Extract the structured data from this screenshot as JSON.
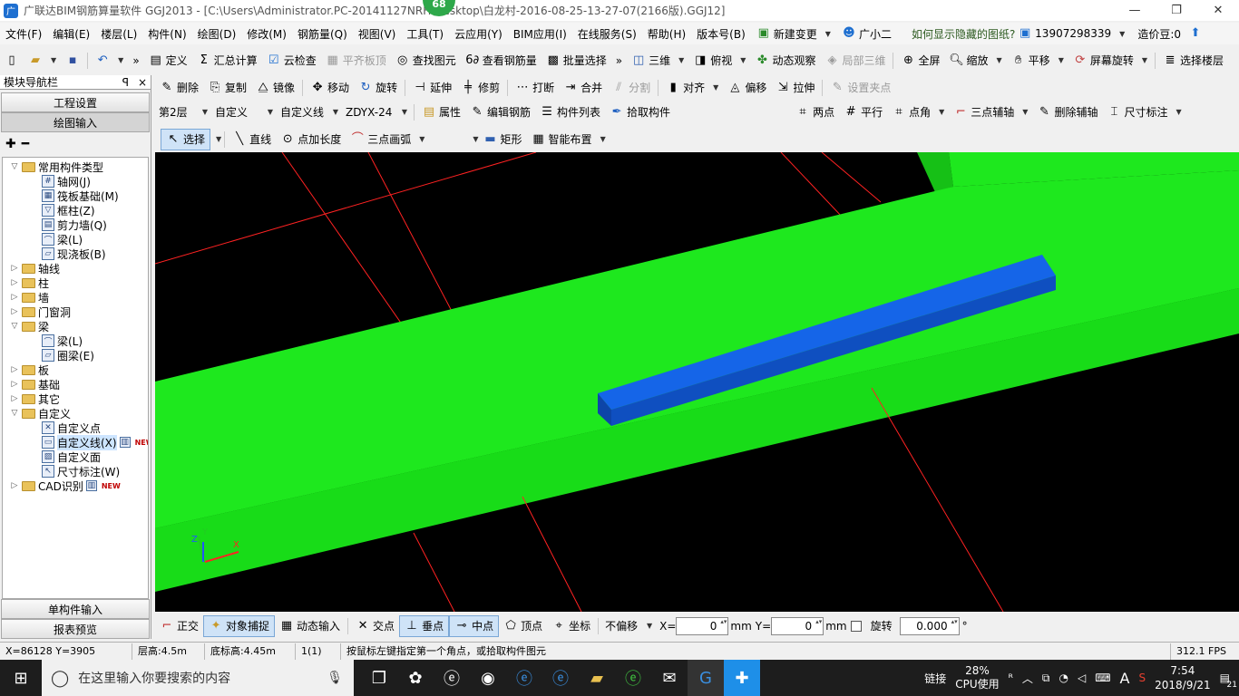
{
  "window": {
    "title": "广联达BIM钢筋算量软件 GGJ2013 - [C:\\Users\\Administrator.PC-20141127NRH\\Desktop\\白龙村-2016-08-25-13-27-07(2166版).GGJ12]",
    "badge": "68",
    "min": "—",
    "restore": "❐",
    "close": "✕"
  },
  "menubar": {
    "items": [
      "文件(F)",
      "编辑(E)",
      "楼层(L)",
      "构件(N)",
      "绘图(D)",
      "修改(M)",
      "钢筋量(Q)",
      "视图(V)",
      "工具(T)",
      "云应用(Y)",
      "BIM应用(I)",
      "在线服务(S)",
      "帮助(H)",
      "版本号(B)"
    ],
    "new_change": "新建变更",
    "guangxiaoer": "广小二",
    "hint": "如何显示隐藏的图纸?",
    "phone": "13907298339",
    "price": "造价豆:0"
  },
  "toolbar1": {
    "define": "定义",
    "sum": "汇总计算",
    "cloud_check": "云检查",
    "flush_slab": "平齐板顶",
    "find": "查找图元",
    "view_rebar": "查看钢筋量",
    "batch_select": "批量选择",
    "three_d": "三维",
    "top_view": "俯视",
    "dynamic": "动态观察",
    "local_3d": "局部三维",
    "fullscreen": "全屏",
    "zoom": "缩放",
    "pan": "平移",
    "rotate_screen": "屏幕旋转",
    "select_floor": "选择楼层"
  },
  "toolbar2": {
    "delete": "删除",
    "copy": "复制",
    "mirror": "镜像",
    "move": "移动",
    "rotate": "旋转",
    "extend": "延伸",
    "trim": "修剪",
    "break": "打断",
    "merge": "合并",
    "split": "分割",
    "align": "对齐",
    "offset": "偏移",
    "stretch": "拉伸",
    "set_grip": "设置夹点"
  },
  "toolbar3": {
    "floor": "第2层",
    "custom": "自定义",
    "custom_line": "自定义线",
    "component": "ZDYX-24",
    "props": "属性",
    "edit_rebar": "编辑钢筋",
    "comp_list": "构件列表",
    "pick": "拾取构件",
    "two_points": "两点",
    "parallel": "平行",
    "point_angle": "点角",
    "three_point_axis": "三点辅轴",
    "delete_axis": "删除辅轴",
    "dimension": "尺寸标注"
  },
  "toolbar4": {
    "select": "选择",
    "line": "直线",
    "point_length": "点加长度",
    "arc": "三点画弧",
    "rect": "矩形",
    "smart": "智能布置"
  },
  "nav": {
    "title": "模块导航栏",
    "pin": "ꟼ",
    "close": "×",
    "project_settings": "工程设置",
    "drawing_input": "绘图输入",
    "single_input": "单构件输入",
    "report": "报表预览",
    "tree": [
      {
        "label": "常用构件类型",
        "kind": "folder",
        "exp": "▽"
      },
      {
        "label": "轴网(J)",
        "kind": "leaf",
        "icon": "#"
      },
      {
        "label": "筏板基础(M)",
        "kind": "leaf",
        "icon": "▦"
      },
      {
        "label": "框柱(Z)",
        "kind": "leaf",
        "icon": "▽"
      },
      {
        "label": "剪力墙(Q)",
        "kind": "leaf",
        "icon": "▤"
      },
      {
        "label": "梁(L)",
        "kind": "leaf",
        "icon": "⌒"
      },
      {
        "label": "现浇板(B)",
        "kind": "leaf",
        "icon": "▱"
      },
      {
        "label": "轴线",
        "kind": "folder",
        "exp": "▷"
      },
      {
        "label": "柱",
        "kind": "folder",
        "exp": "▷"
      },
      {
        "label": "墙",
        "kind": "folder",
        "exp": "▷"
      },
      {
        "label": "门窗洞",
        "kind": "folder",
        "exp": "▷"
      },
      {
        "label": "梁",
        "kind": "folder",
        "exp": "▽"
      },
      {
        "label": "梁(L)",
        "kind": "leaf",
        "icon": "⌒"
      },
      {
        "label": "圈梁(E)",
        "kind": "leaf",
        "icon": "▱"
      },
      {
        "label": "板",
        "kind": "folder",
        "exp": "▷"
      },
      {
        "label": "基础",
        "kind": "folder",
        "exp": "▷"
      },
      {
        "label": "其它",
        "kind": "folder",
        "exp": "▷"
      },
      {
        "label": "自定义",
        "kind": "folder",
        "exp": "▽"
      },
      {
        "label": "自定义点",
        "kind": "leaf",
        "icon": "✕"
      },
      {
        "label": "自定义线(X)",
        "kind": "leaf",
        "icon": "▭"
      },
      {
        "label": "自定义面",
        "kind": "leaf",
        "icon": "▨"
      },
      {
        "label": "尺寸标注(W)",
        "kind": "leaf",
        "icon": "↖"
      },
      {
        "label": "CAD识别",
        "kind": "folder",
        "exp": "▷"
      }
    ],
    "new_tag": "NEW"
  },
  "snapbar": {
    "ortho": "正交",
    "snap": "对象捕捉",
    "dynamic_input": "动态输入",
    "intersection": "交点",
    "perpendicular": "垂点",
    "midpoint": "中点",
    "vertex": "顶点",
    "coordinate": "坐标",
    "offset_mode": "不偏移",
    "x_label": "X=",
    "x_value": "0",
    "y_label": "Y=",
    "y_value": "0",
    "unit": "mm",
    "rotate_label": "旋转",
    "rotate_value": "0.000",
    "degree": "°"
  },
  "status": {
    "coords": "X=86128 Y=3905",
    "floor_height": "层高:4.5m",
    "base_height": "底标高:4.45m",
    "count": "1(1)",
    "prompt": "按鼠标左键指定第一个角点，或拾取构件图元",
    "fps": "312.1 FPS"
  },
  "taskbar": {
    "search_placeholder": "在这里输入你要搜索的内容",
    "link": "链接",
    "cpu_percent": "28%",
    "cpu_label": "CPU使用",
    "ime": "A",
    "time": "7:54",
    "date": "2018/9/21",
    "notif_count": "21"
  },
  "axes_gizmo": {
    "y_label": "Y",
    "x_label": "X",
    "z_label": "Z"
  },
  "colors": {
    "viewport_bg": "#000000",
    "slab_green": "#1ee81e",
    "beam_blue": "#1565e8",
    "grid_red": "#ff2020"
  }
}
